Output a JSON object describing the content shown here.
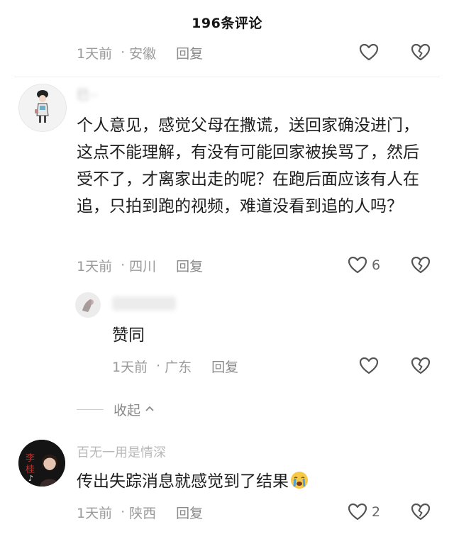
{
  "header": {
    "title": "196条评论"
  },
  "top_comment_meta": {
    "time": "1天前",
    "location": "安徽",
    "reply_label": "回复"
  },
  "comments": [
    {
      "username": "巳··",
      "text": "个人意见，感觉父母在撒谎，送回家确没进门，这点不能理解，有没有可能回家被挨骂了，然后受不了，才离家出走的呢？在跑后面应该有人在追，只拍到跑的视频，难道没看到追的人吗？",
      "time": "1天前",
      "location": "四川",
      "reply_label": "回复",
      "like_count": "6",
      "replies": [
        {
          "username": "",
          "text": "赞同",
          "time": "1天前",
          "location": "广东",
          "reply_label": "回复"
        }
      ]
    },
    {
      "username": "百无一用是情深",
      "text": "传出失踪消息就感觉到了结果",
      "emoji": "loudly-crying-face",
      "time": "1天前",
      "location": "陕西",
      "reply_label": "回复",
      "like_count": "2"
    }
  ],
  "collapse": {
    "label": "收起"
  },
  "colors": {
    "muted_text": "#9a9a9a",
    "icon_stroke": "#555555"
  }
}
